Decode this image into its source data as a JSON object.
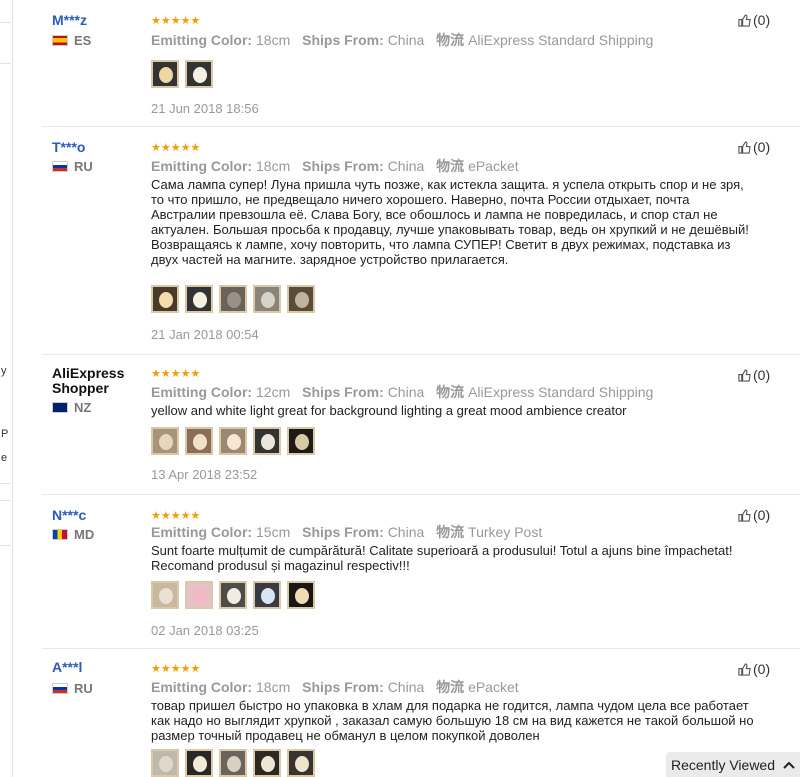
{
  "left_fragments": [
    "y",
    "P",
    "e"
  ],
  "reviews": [
    {
      "name": "M***z",
      "country": "ES",
      "stars": "★★★★★",
      "color_label": "Emitting Color:",
      "color_value": "18cm",
      "ships_label": "Ships From:",
      "ships_value": "China",
      "logistics_label": "物流",
      "logistics_value": "AliExpress Standard Shipping",
      "text": "",
      "date": "21 Jun 2018 18:56",
      "likes": "(0)",
      "thumb_count": 2
    },
    {
      "name": "T***o",
      "country": "RU",
      "stars": "★★★★★",
      "color_label": "Emitting Color:",
      "color_value": "18cm",
      "ships_label": "Ships From:",
      "ships_value": "China",
      "logistics_label": "物流",
      "logistics_value": "ePacket",
      "text": "Сама лампа супер! Луна пришла чуть позже, как истекла защита. я успела открыть спор и не зря, то что пришло, не предвещало ничего хорошего. Наверно, почта России отдыхает, почта Австралии превзошла её. Слава Богу, все обошлось и лампа не повредилась, и спор стал не актуален. Большая просьба к продавцу, лучше упаковывать товар, ведь он хрупкий и не дешёвый! Возвращаясь к лампе, хочу повторить, что лампа СУПЕР! Светит в двух режимах, подставка из двух частей на магните. зарядное устройство прилагается.",
      "date": "21 Jan 2018 00:54",
      "likes": "(0)",
      "thumb_count": 5
    },
    {
      "name": "AliExpress Shopper",
      "country": "NZ",
      "stars": "★★★★★",
      "color_label": "Emitting Color:",
      "color_value": "12cm",
      "ships_label": "Ships From:",
      "ships_value": "China",
      "logistics_label": "物流",
      "logistics_value": "AliExpress Standard Shipping",
      "text": "yellow and white light great for background lighting a great mood ambience creator",
      "date": "13 Apr 2018 23:52",
      "likes": "(0)",
      "thumb_count": 5
    },
    {
      "name": "N***c",
      "country": "MD",
      "stars": "★★★★★",
      "color_label": "Emitting Color:",
      "color_value": "15cm",
      "ships_label": "Ships From:",
      "ships_value": "China",
      "logistics_label": "物流",
      "logistics_value": "Turkey Post",
      "text": "Sunt foarte mulțumit de cumpărătură! Calitate superioară a produsului! Totul a ajuns bine împachetat! Recomand produsul și magazinul respectiv!!!",
      "date": "02 Jan 2018 03:25",
      "likes": "(0)",
      "thumb_count": 5
    },
    {
      "name": "A***l",
      "country": "RU",
      "stars": "★★★★★",
      "color_label": "Emitting Color:",
      "color_value": "18cm",
      "ships_label": "Ships From:",
      "ships_value": "China",
      "logistics_label": "物流",
      "logistics_value": "ePacket",
      "text": "товар пришел быстро но упаковка в хлам для подарка не годится, лампа чудом цела все работает как надо но выглядит хрупкой , заказал самую большую 18 см на вид кажется не такой большой но размер точный продавец не обманул в целом покупкой доволен",
      "date": "",
      "likes": "(0)",
      "thumb_count": 5
    }
  ],
  "recently_viewed": {
    "label": "Recently Viewed",
    "icon": "chevron-up-icon"
  },
  "colors": {
    "name_blue": "#2a5bbd",
    "star_orange": "#f29d00",
    "muted_gray": "#999999"
  }
}
